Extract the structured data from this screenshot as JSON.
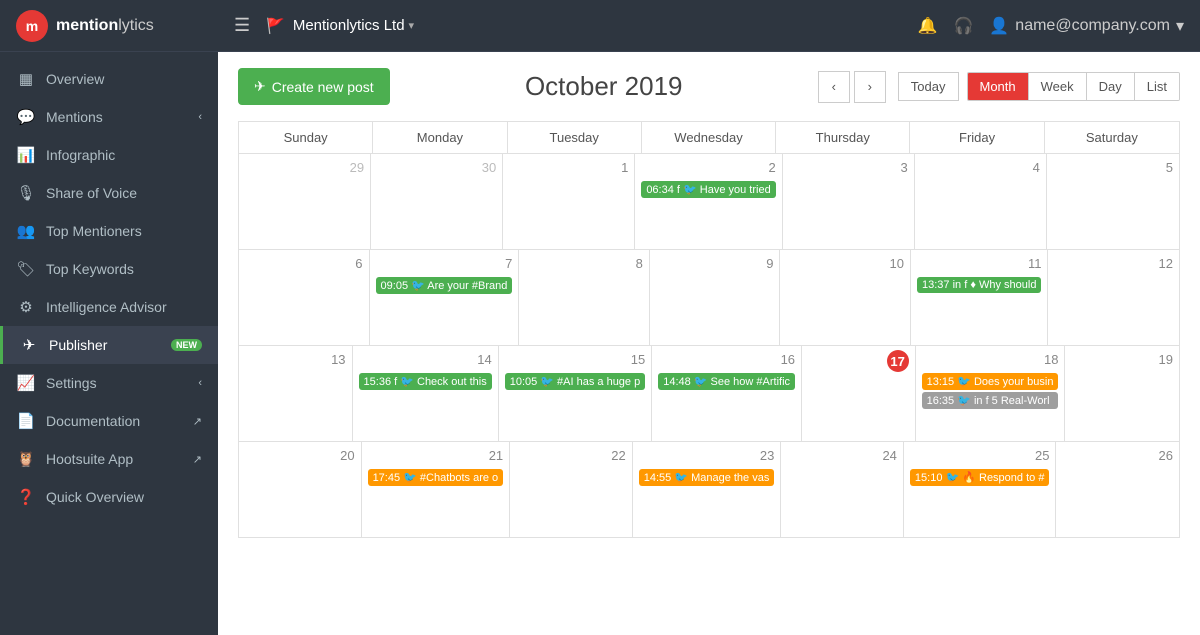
{
  "app": {
    "logo_letter": "m",
    "logo_name": "mention",
    "logo_name2": "lytics"
  },
  "topbar": {
    "hamburger": "☰",
    "brand": "Mentionlytics Ltd",
    "brand_chevron": "▾",
    "bell_icon": "🔔",
    "headset_icon": "🎧",
    "user_icon": "👤",
    "user_name": "name@company.com",
    "user_chevron": "▾"
  },
  "sidebar": {
    "items": [
      {
        "id": "overview",
        "icon": "▦",
        "label": "Overview",
        "arrow": "",
        "badge": ""
      },
      {
        "id": "mentions",
        "icon": "💬",
        "label": "Mentions",
        "arrow": "‹",
        "badge": ""
      },
      {
        "id": "infographic",
        "icon": "📊",
        "label": "Infographic",
        "arrow": "",
        "badge": ""
      },
      {
        "id": "share-of-voice",
        "icon": "🎙",
        "label": "Share of Voice",
        "arrow": "",
        "badge": ""
      },
      {
        "id": "top-mentioners",
        "icon": "👥",
        "label": "Top Mentioners",
        "arrow": "",
        "badge": ""
      },
      {
        "id": "top-keywords",
        "icon": "🏷",
        "label": "Top Keywords",
        "arrow": "",
        "badge": ""
      },
      {
        "id": "intelligence-advisor",
        "icon": "⚙",
        "label": "Intelligence Advisor",
        "arrow": "",
        "badge": ""
      },
      {
        "id": "publisher",
        "icon": "✈",
        "label": "Publisher",
        "arrow": "",
        "badge": "NEW"
      },
      {
        "id": "settings",
        "icon": "📈",
        "label": "Settings",
        "arrow": "‹",
        "badge": ""
      },
      {
        "id": "documentation",
        "icon": "📄",
        "label": "Documentation",
        "arrow": "↗",
        "badge": ""
      },
      {
        "id": "hootsuite-app",
        "icon": "🦉",
        "label": "Hootsuite App",
        "arrow": "↗",
        "badge": ""
      },
      {
        "id": "quick-overview",
        "icon": "❓",
        "label": "Quick Overview",
        "arrow": "",
        "badge": ""
      }
    ]
  },
  "calendar": {
    "create_btn_icon": "✈",
    "create_btn_label": "Create new post",
    "title": "October 2019",
    "today_label": "Today",
    "view_month": "Month",
    "view_week": "Week",
    "view_day": "Day",
    "view_list": "List",
    "day_names": [
      "Sunday",
      "Monday",
      "Tuesday",
      "Wednesday",
      "Thursday",
      "Friday",
      "Saturday"
    ],
    "weeks": [
      {
        "days": [
          {
            "num": "29",
            "other": true,
            "events": []
          },
          {
            "num": "30",
            "other": true,
            "events": []
          },
          {
            "num": "1",
            "other": false,
            "events": []
          },
          {
            "num": "2",
            "other": false,
            "events": [
              {
                "color": "green",
                "text": "06:34 f 🐦 Have you tried"
              }
            ]
          },
          {
            "num": "3",
            "other": false,
            "events": []
          },
          {
            "num": "4",
            "other": false,
            "events": []
          },
          {
            "num": "5",
            "other": false,
            "events": []
          }
        ]
      },
      {
        "days": [
          {
            "num": "6",
            "other": false,
            "events": []
          },
          {
            "num": "7",
            "other": false,
            "events": [
              {
                "color": "green",
                "text": "09:05 🐦 Are your #Brand"
              }
            ]
          },
          {
            "num": "8",
            "other": false,
            "events": []
          },
          {
            "num": "9",
            "other": false,
            "events": []
          },
          {
            "num": "10",
            "other": false,
            "events": []
          },
          {
            "num": "11",
            "other": false,
            "events": [
              {
                "color": "green",
                "text": "13:37 in f ♦ Why should"
              }
            ]
          },
          {
            "num": "12",
            "other": false,
            "events": []
          }
        ]
      },
      {
        "days": [
          {
            "num": "13",
            "other": false,
            "events": []
          },
          {
            "num": "14",
            "other": false,
            "events": [
              {
                "color": "green",
                "text": "15:36 f 🐦 Check out this"
              }
            ]
          },
          {
            "num": "15",
            "other": false,
            "events": [
              {
                "color": "green",
                "text": "10:05 🐦 #AI has a huge p"
              }
            ]
          },
          {
            "num": "16",
            "other": false,
            "events": [
              {
                "color": "green",
                "text": "14:48 🐦 See how #Artific"
              }
            ]
          },
          {
            "num": "17",
            "other": false,
            "today": true,
            "events": []
          },
          {
            "num": "18",
            "other": false,
            "events": [
              {
                "color": "orange",
                "text": "13:15 🐦 Does your busin"
              },
              {
                "color": "gray",
                "text": "16:35 🐦 in f 5 Real-Worl"
              }
            ]
          },
          {
            "num": "19",
            "other": false,
            "events": []
          }
        ]
      },
      {
        "days": [
          {
            "num": "20",
            "other": false,
            "events": []
          },
          {
            "num": "21",
            "other": false,
            "events": [
              {
                "color": "orange",
                "text": "17:45 🐦 #Chatbots are o"
              }
            ]
          },
          {
            "num": "22",
            "other": false,
            "events": []
          },
          {
            "num": "23",
            "other": false,
            "events": [
              {
                "color": "orange",
                "text": "14:55 🐦 Manage the vas"
              }
            ]
          },
          {
            "num": "24",
            "other": false,
            "events": []
          },
          {
            "num": "25",
            "other": false,
            "events": [
              {
                "color": "orange",
                "text": "15:10 🐦 🔥 Respond to #"
              }
            ]
          },
          {
            "num": "26",
            "other": false,
            "events": []
          }
        ]
      }
    ]
  }
}
